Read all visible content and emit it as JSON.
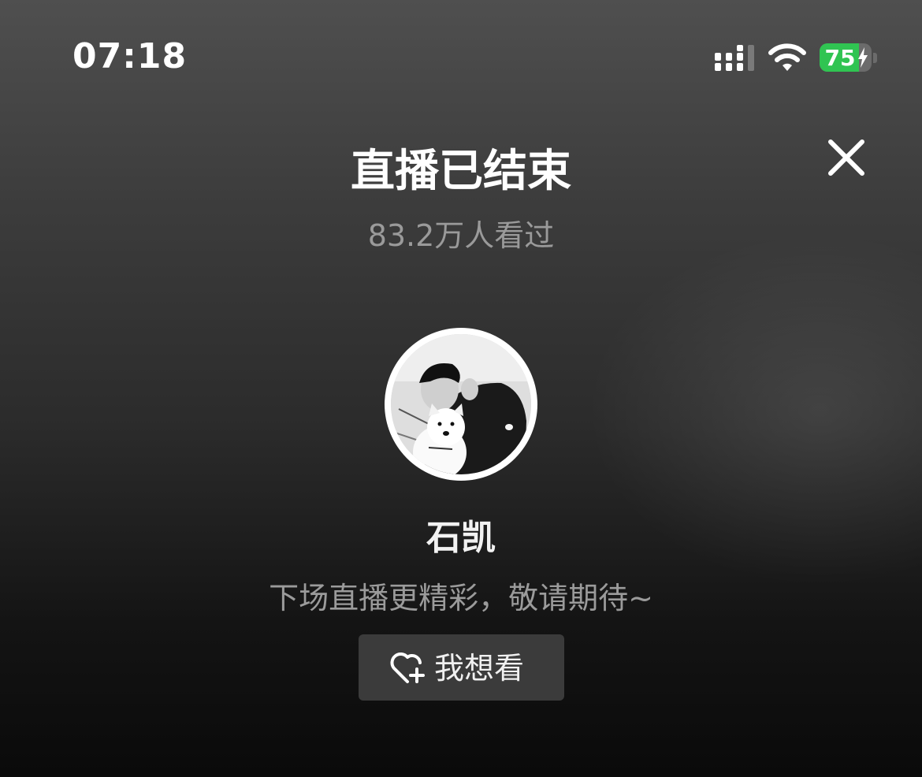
{
  "status_bar": {
    "time": "07:18",
    "battery_level": "75",
    "battery_fraction": 0.75,
    "battery_color": "#30c452",
    "icons": [
      "cellular-signal-icon",
      "wifi-icon",
      "battery-charging-icon"
    ]
  },
  "header": {
    "title": "直播已结束",
    "viewers": "83.2万人看过",
    "close_icon": "close-icon"
  },
  "streamer": {
    "name": "石凯",
    "tagline": "下场直播更精彩，敬请期待~"
  },
  "action": {
    "want_label": "我想看",
    "icon": "heart-plus-icon"
  }
}
